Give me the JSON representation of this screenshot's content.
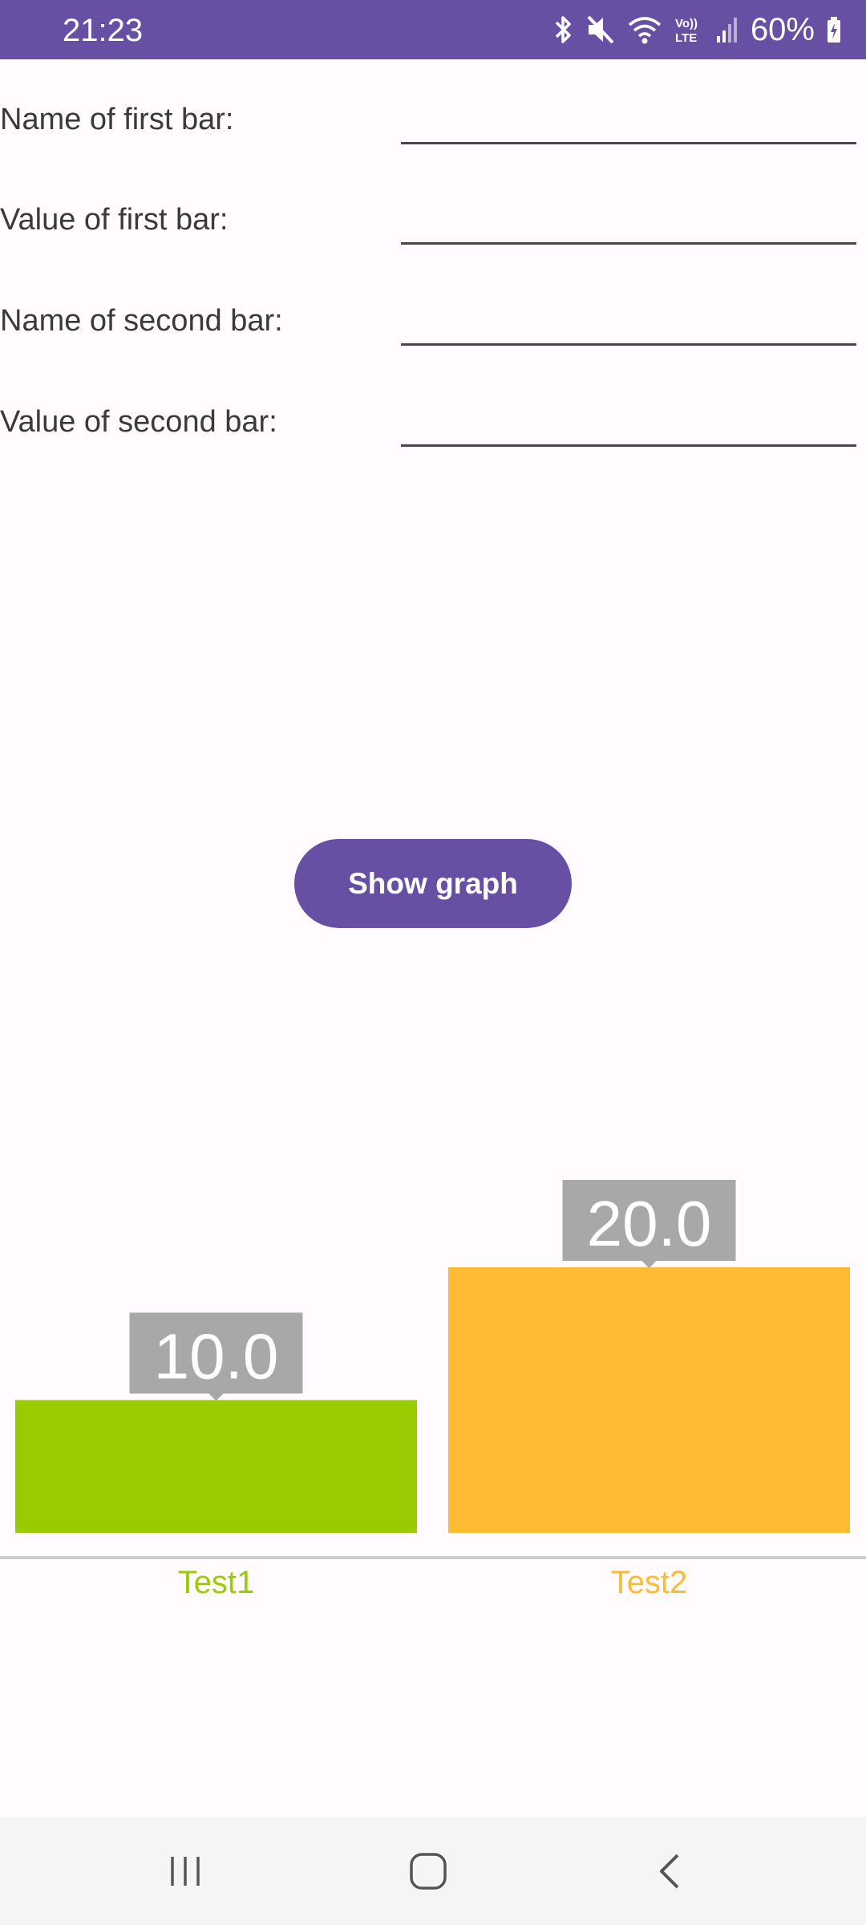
{
  "status_bar": {
    "time": "21:23",
    "battery": "60%",
    "icons": [
      "bluetooth-icon",
      "mute-icon",
      "wifi-icon",
      "volte-icon",
      "signal-icon",
      "battery-icon"
    ],
    "background": "#6750a4"
  },
  "form": {
    "first_name_label": "Name of first bar:",
    "first_name_value": "",
    "first_value_label": "Value of first bar:",
    "first_value_value": "",
    "second_name_label": "Name of second bar:",
    "second_name_value": "",
    "second_value_label": "Value of second bar:",
    "second_value_value": ""
  },
  "button": {
    "label": "Show graph",
    "color": "#6750a4"
  },
  "chart_data": {
    "type": "bar",
    "categories": [
      "Test1",
      "Test2"
    ],
    "values": [
      10.0,
      20.0
    ],
    "value_labels": [
      "10.0",
      "20.0"
    ],
    "colors": [
      "#99cc00",
      "#ffbb33"
    ],
    "label_box_color": "#a8a8a8",
    "ylim": [
      0,
      20
    ],
    "grid": false
  },
  "nav_bar": {
    "icons": [
      "recent-apps-icon",
      "home-icon",
      "back-icon"
    ]
  }
}
